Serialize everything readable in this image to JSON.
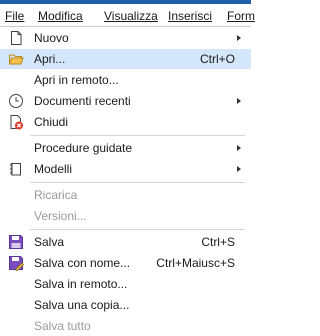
{
  "menubar": {
    "file": "File",
    "modifica": "Modifica",
    "visualizza": "Visualizza",
    "inserisci": "Inserisci",
    "formato": "Form"
  },
  "menu": {
    "nuovo": "Nuovo",
    "apri": "Apri...",
    "apri_shortcut": "Ctrl+O",
    "apri_remoto": "Apri in remoto...",
    "documenti_recenti": "Documenti recenti",
    "chiudi": "Chiudi",
    "procedure_guidate": "Procedure guidate",
    "modelli": "Modelli",
    "ricarica": "Ricarica",
    "versioni": "Versioni...",
    "salva": "Salva",
    "salva_shortcut": "Ctrl+S",
    "salva_con_nome": "Salva con nome...",
    "salva_con_nome_shortcut": "Ctrl+Maiusc+S",
    "salva_remoto": "Salva in remoto...",
    "salva_copia": "Salva una copia...",
    "salva_tutto": "Salva tutto"
  },
  "colors": {
    "highlight": "#d4e6f9",
    "title_bar": "#1e5fa8",
    "disabled_text": "#9a9a9a",
    "save_icon": "#7a4bbd"
  }
}
